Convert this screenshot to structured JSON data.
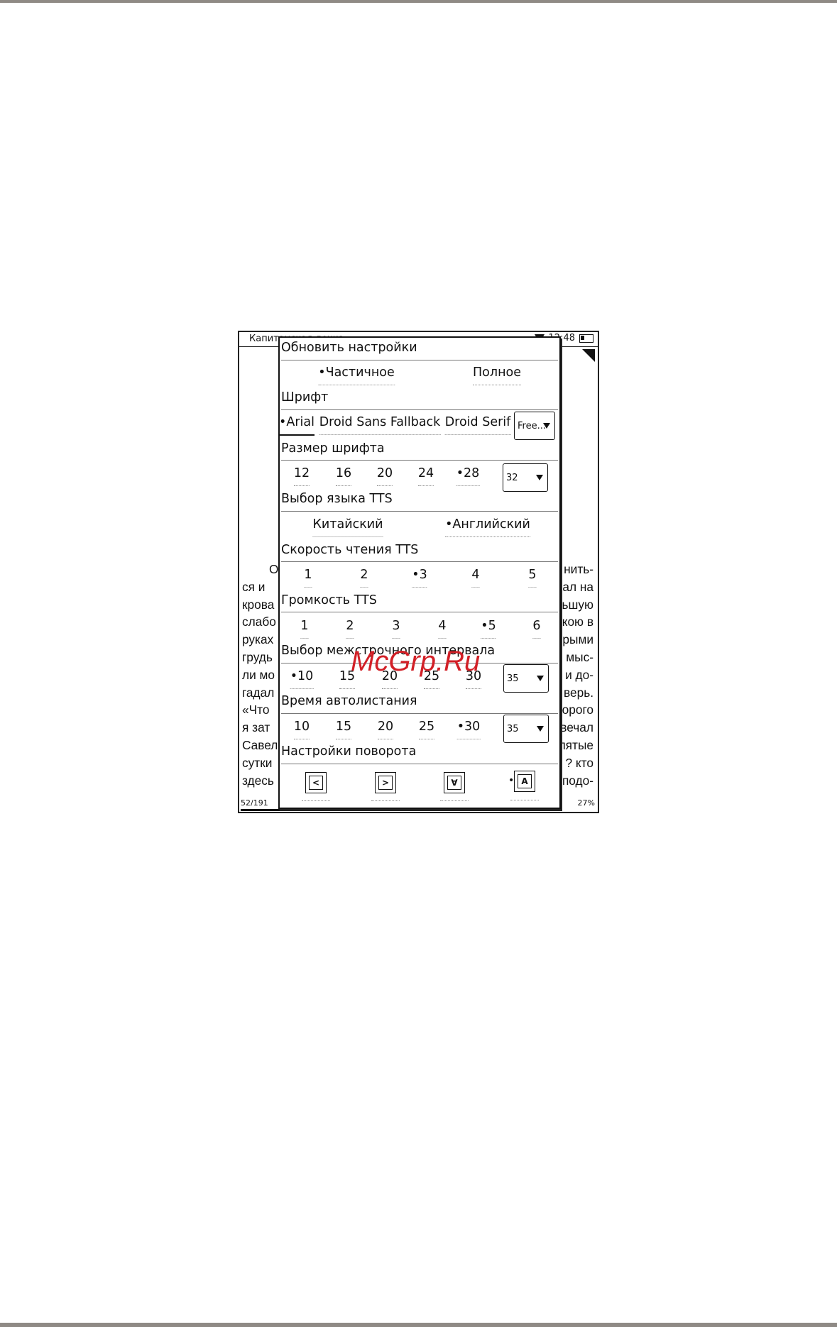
{
  "statusbar": {
    "book_title": "Капитанская дочка",
    "time": "12:48"
  },
  "book": {
    "lines": [
      {
        "left": "О",
        "right": "нить-"
      },
      {
        "left": "ся и",
        "right": "ал на"
      },
      {
        "left": "крова",
        "right": "ьшую"
      },
      {
        "left": "слабо",
        "right": "кою в"
      },
      {
        "left": "руках",
        "right": "рыми"
      },
      {
        "left": "грудь",
        "right": "мыс-"
      },
      {
        "left": "ли мо",
        "right": "и до-"
      },
      {
        "left": "гадал",
        "right": "верь."
      },
      {
        "left": "«Что",
        "right": "орого"
      },
      {
        "left": "я зат",
        "right": "вечал"
      },
      {
        "left": "Савел",
        "right": "пятые"
      },
      {
        "left": "сутки",
        "right": "? кто"
      },
      {
        "left": "здесь",
        "right": "подо-"
      }
    ],
    "page_number": "52/191",
    "percent": "27%",
    "progress": 0.27
  },
  "settings": {
    "refresh": {
      "title": "Обновить настройки",
      "options": [
        "•Частичное",
        "Полное"
      ]
    },
    "font": {
      "title": "Шрифт",
      "options": [
        "•Arial",
        "Droid Sans Fallback",
        "Droid Serif"
      ],
      "dropdown": "Free..."
    },
    "font_size": {
      "title": "Размер шрифта",
      "options": [
        "12",
        "16",
        "20",
        "24",
        "•28"
      ],
      "dropdown": "32"
    },
    "tts_language": {
      "title": "Выбор языка TTS",
      "options": [
        "Китайский",
        "•Английский"
      ]
    },
    "tts_speed": {
      "title": "Скорость чтения TTS",
      "options": [
        "1",
        "2",
        "•3",
        "4",
        "5"
      ]
    },
    "tts_volume": {
      "title": "Громкость TTS",
      "options": [
        "1",
        "2",
        "3",
        "4",
        "•5",
        "6"
      ]
    },
    "line_spacing": {
      "title": "Выбор межстрочного интервала",
      "options": [
        "•10",
        "15",
        "20",
        "25",
        "30"
      ],
      "dropdown": "35"
    },
    "autoflip": {
      "title": "Время автолистания",
      "options": [
        "10",
        "15",
        "20",
        "25",
        "•30"
      ],
      "dropdown": "35"
    },
    "rotation": {
      "title": "Настройки поворота",
      "icons": [
        "rotate-left-icon",
        "rotate-right-icon",
        "rotate-180-icon",
        "rotate-portrait-icon"
      ],
      "glyphs": [
        "<",
        ">",
        "∀",
        "A"
      ],
      "selected_marker": "•"
    }
  },
  "watermark": "McGrp.Ru"
}
